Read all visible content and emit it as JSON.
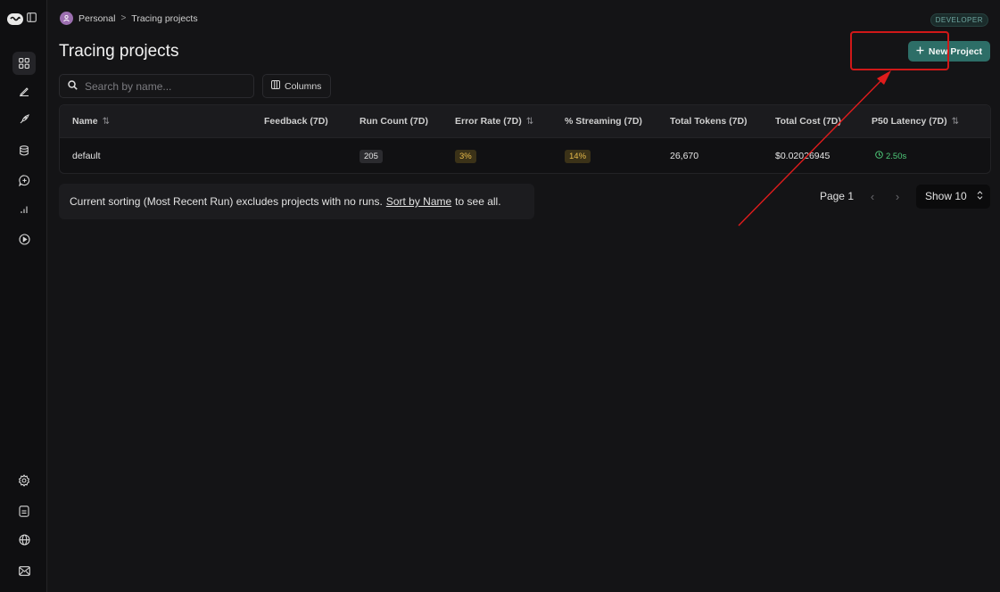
{
  "sidebar": {
    "top_icons": [
      "logo-icon",
      "panel-toggle-icon"
    ],
    "nav_icons": [
      "grid-icon",
      "pen-icon",
      "rocket-icon",
      "database-icon",
      "chat-add-icon",
      "bar-chart-icon",
      "play-circle-icon"
    ],
    "bottom_icons": [
      "settings-icon",
      "document-icon",
      "globe-icon",
      "mail-icon"
    ]
  },
  "breadcrumb": {
    "workspace": "Personal",
    "separator": ">",
    "current": "Tracing projects"
  },
  "badge": "DEVELOPER",
  "page_title": "Tracing projects",
  "new_project_label": "New Project",
  "search": {
    "placeholder": "Search by name...",
    "value": ""
  },
  "columns_label": "Columns",
  "table": {
    "headers": [
      "Name",
      "Feedback (7D)",
      "Run Count (7D)",
      "Error Rate (7D)",
      "% Streaming (7D)",
      "Total Tokens (7D)",
      "Total Cost (7D)",
      "P50 Latency (7D)"
    ],
    "rows": [
      {
        "name": "default",
        "feedback": "",
        "run_count": "205",
        "error_rate": "3%",
        "streaming": "14%",
        "total_tokens": "26,670",
        "total_cost": "$0.02026945",
        "p50_latency": "2.50s"
      }
    ]
  },
  "notice": {
    "before": "Current sorting (Most Recent Run) excludes projects with no runs.",
    "link": "Sort by Name",
    "after": "to see all."
  },
  "pagination": {
    "page_label": "Page 1",
    "show_label": "Show 10"
  },
  "colors": {
    "accent": "#2d6e67",
    "highlight": "#d01818",
    "warning": "#e5b94a",
    "success": "#4fca7a"
  }
}
